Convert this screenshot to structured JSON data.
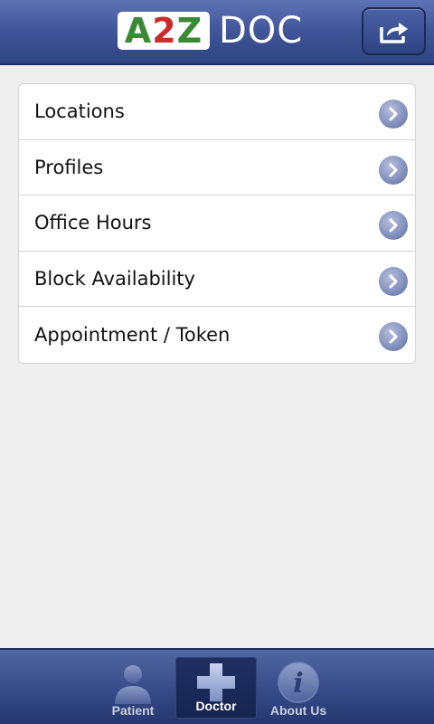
{
  "header": {
    "logo": {
      "part1_a": "A",
      "part1_2": "2",
      "part1_z": "Z",
      "part2": "DOC"
    },
    "share_icon": "share-icon"
  },
  "menu": {
    "items": [
      {
        "label": "Locations",
        "icon": "chevron-right-icon"
      },
      {
        "label": "Profiles",
        "icon": "chevron-right-icon"
      },
      {
        "label": "Office Hours",
        "icon": "chevron-right-icon"
      },
      {
        "label": "Block Availability",
        "icon": "chevron-right-icon"
      },
      {
        "label": "Appointment / Token",
        "icon": "chevron-right-icon"
      }
    ]
  },
  "tabbar": {
    "tabs": [
      {
        "label": "Patient",
        "icon": "person-icon",
        "active": false
      },
      {
        "label": "Doctor",
        "icon": "plus-cross-icon",
        "active": true
      },
      {
        "label": "About Us",
        "icon": "info-icon",
        "active": false
      }
    ]
  },
  "colors": {
    "header": "#3f5598",
    "logo_green": "#3a8a35",
    "logo_red": "#cc2b2b",
    "background": "#eeeeee",
    "arrow": "#8492bf"
  }
}
